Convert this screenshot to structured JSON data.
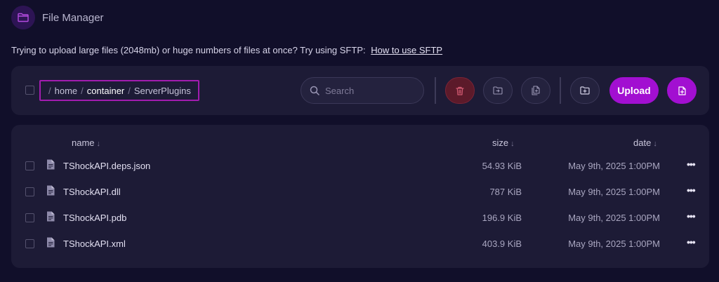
{
  "app": {
    "title": "File Manager"
  },
  "notice": {
    "text": "Trying to upload large files (2048mb) or huge numbers of files at once? Try using SFTP:",
    "link": "How to use SFTP"
  },
  "breadcrumb": {
    "separator": "/",
    "segments": [
      "home",
      "container",
      "ServerPlugins"
    ]
  },
  "search": {
    "placeholder": "Search"
  },
  "toolbar": {
    "upload_label": "Upload"
  },
  "table": {
    "headers": {
      "name": "name",
      "size": "size",
      "date": "date"
    },
    "sort_arrow": "↓",
    "rows": [
      {
        "name": "TShockAPI.deps.json",
        "size": "54.93 KiB",
        "date": "May 9th, 2025 1:00PM",
        "more": "•••"
      },
      {
        "name": "TShockAPI.dll",
        "size": "787 KiB",
        "date": "May 9th, 2025 1:00PM",
        "more": "•••"
      },
      {
        "name": "TShockAPI.pdb",
        "size": "196.9 KiB",
        "date": "May 9th, 2025 1:00PM",
        "more": "•••"
      },
      {
        "name": "TShockAPI.xml",
        "size": "403.9 KiB",
        "date": "May 9th, 2025 1:00PM",
        "more": "•••"
      }
    ]
  },
  "colors": {
    "background": "#110f2a",
    "panel": "#1d1b36",
    "accent": "#a20fd1",
    "danger": "#5c1a2a"
  },
  "icons": {
    "header": "folder-icon",
    "search": "search-icon",
    "delete": "trash-icon",
    "move": "folder-move-icon",
    "copy": "file-copy-icon",
    "new_folder": "folder-plus-icon",
    "new_file": "file-plus-icon",
    "file": "file-text-icon",
    "row_menu": "more-horizontal-icon"
  }
}
